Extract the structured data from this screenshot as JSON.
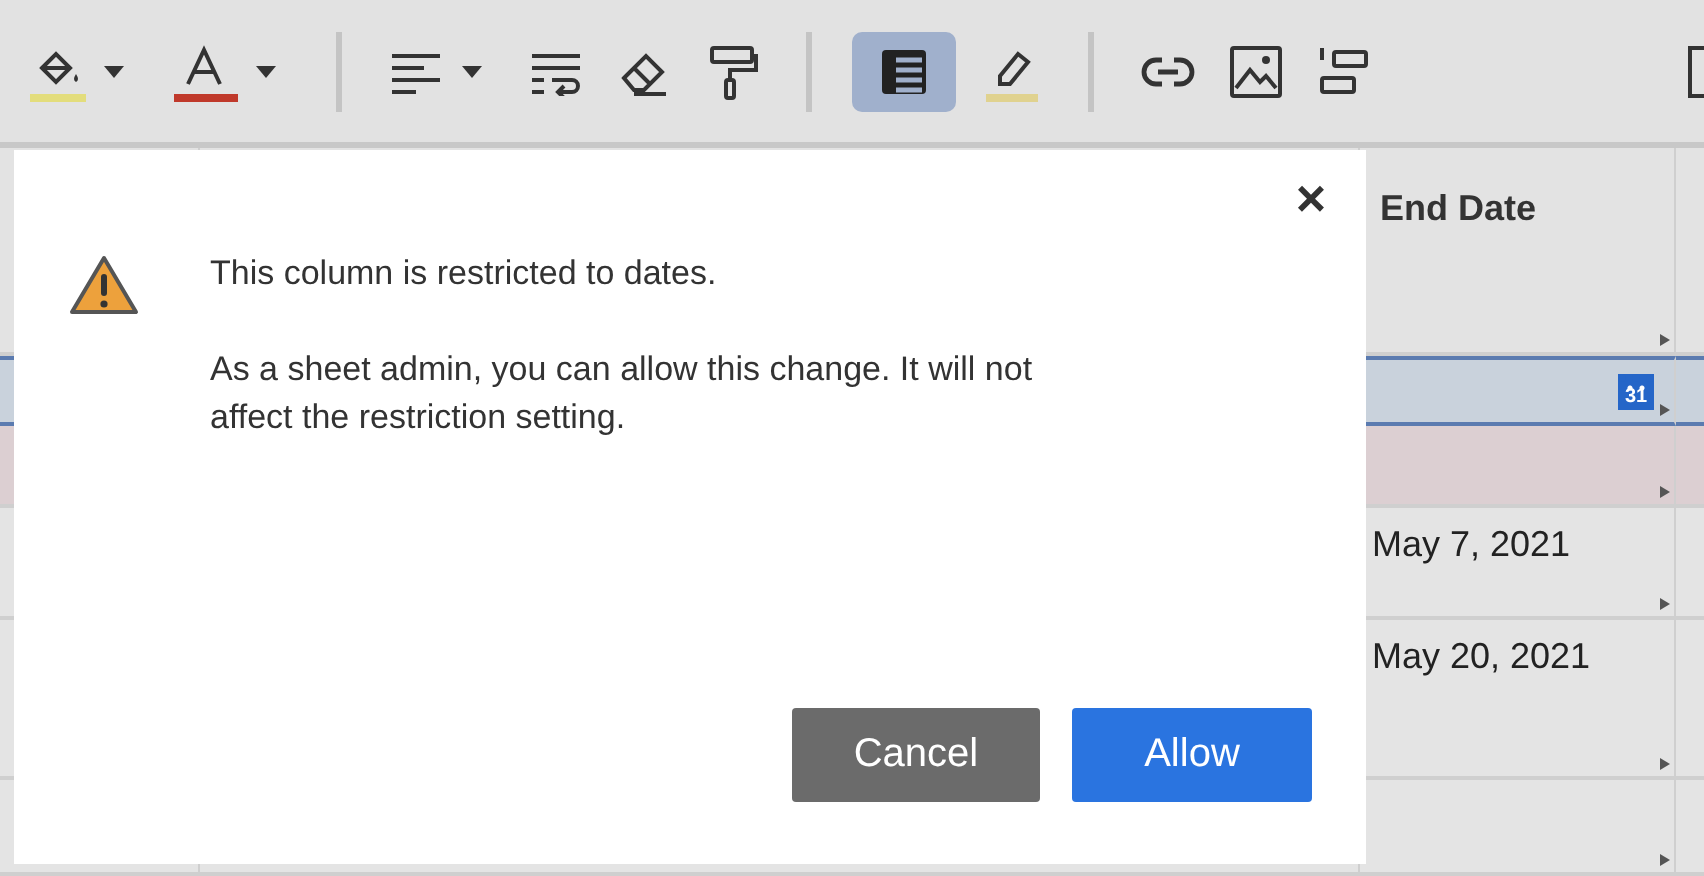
{
  "toolbar": {
    "table_view": {
      "selected": true
    }
  },
  "grid": {
    "header": {
      "column_3": "End Date"
    },
    "rows": [
      {
        "kind": "selected",
        "calendar_day": "31"
      },
      {
        "kind": "highlighted"
      },
      {
        "kind": "normal",
        "column_3": "May 7, 2021"
      },
      {
        "kind": "normal",
        "column_3": "May 20, 2021"
      },
      {
        "kind": "normal"
      }
    ]
  },
  "dialog": {
    "message": "This column is restricted to dates.",
    "detail": "As a sheet admin, you can allow this change. It will not affect the restriction setting.",
    "close": "×",
    "buttons": [
      {
        "label": "Cancel",
        "kind": "secondary"
      },
      {
        "label": "Allow",
        "kind": "primary"
      }
    ]
  }
}
